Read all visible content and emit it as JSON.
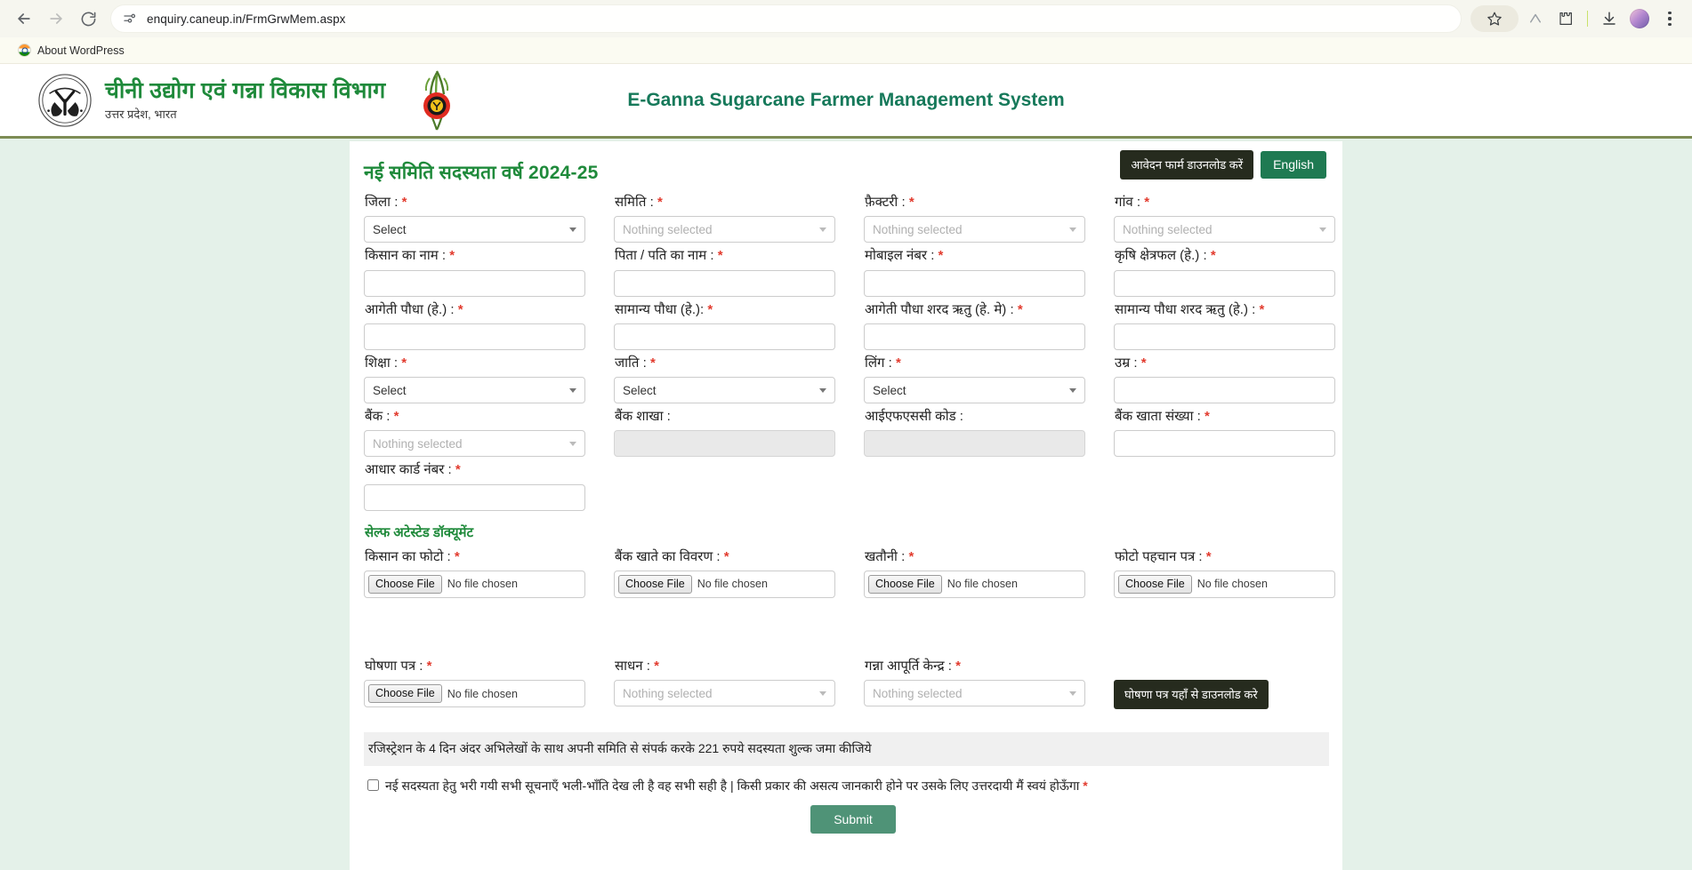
{
  "browser": {
    "url": "enquiry.caneup.in/FrmGrwMem.aspx",
    "back_icon": "back-arrow-icon",
    "forward_icon": "forward-arrow-icon",
    "reload_icon": "reload-icon",
    "site_info_icon": "site-settings-icon",
    "bookmarks": [
      {
        "label": "About WordPress",
        "icon": "india-flag-favicon"
      }
    ],
    "toolbar_icons": [
      "bookmark-star-icon",
      "lens-icon",
      "extensions-puzzle-icon",
      "downloads-icon",
      "profile-avatar",
      "chrome-menu-icon"
    ]
  },
  "site_header": {
    "emblem_icon": "up-government-emblem",
    "dept_title": "चीनी उद्योग एवं गन्ना विकास विभाग",
    "dept_subtitle": "उत्तर प्रदेश, भारत",
    "cane_logo_icon": "sugarcane-logo",
    "system_title": "E-Ganna Sugarcane Farmer Management System"
  },
  "colors": {
    "green": "#1f8a3b",
    "teal": "#16795a",
    "dark_button": "#262b1e",
    "green_button": "#1f7a52",
    "page_bg": "#e4f1e9",
    "required_star": "#e23b2e"
  },
  "form": {
    "title": "नई समिति सदस्यता वर्ष 2024-25",
    "download_form_button": "आवेदन फार्म डाउनलोड करें",
    "language_button": "English",
    "rows": [
      [
        {
          "label": "जिला :",
          "required": true,
          "type": "select",
          "value": "Select",
          "placeholder": false,
          "name": "district"
        },
        {
          "label": "समिति :",
          "required": true,
          "type": "select",
          "value": "Nothing selected",
          "placeholder": true,
          "name": "samiti"
        },
        {
          "label": "फ़ैक्टरी :",
          "required": true,
          "type": "select",
          "value": "Nothing selected",
          "placeholder": true,
          "name": "factory"
        },
        {
          "label": "गांव :",
          "required": true,
          "type": "select",
          "value": "Nothing selected",
          "placeholder": true,
          "name": "village"
        }
      ],
      [
        {
          "label": "किसान का नाम :",
          "required": true,
          "type": "text",
          "value": "",
          "name": "farmer-name"
        },
        {
          "label": "पिता / पति का नाम :",
          "required": true,
          "type": "text",
          "value": "",
          "name": "father-husband-name"
        },
        {
          "label": "मोबाइल नंबर :",
          "required": true,
          "type": "text",
          "value": "",
          "name": "mobile-number"
        },
        {
          "label": "कृषि क्षेत्रफल (हे.) :",
          "required": true,
          "type": "text",
          "value": "",
          "name": "agriculture-area"
        }
      ],
      [
        {
          "label": "आगेती पौधा (हे.) :",
          "required": true,
          "type": "text",
          "value": "",
          "name": "early-plant-area"
        },
        {
          "label": "सामान्य पौधा (हे.):",
          "required": true,
          "type": "text",
          "value": "",
          "name": "normal-plant-area"
        },
        {
          "label": "आगेती पौधा शरद ऋतु (हे. मे) :",
          "required": true,
          "type": "text",
          "value": "",
          "name": "early-plant-autumn"
        },
        {
          "label": "सामान्य पौधा शरद ऋतु (हे.) :",
          "required": true,
          "type": "text",
          "value": "",
          "name": "normal-plant-autumn"
        }
      ],
      [
        {
          "label": "शिक्षा :",
          "required": true,
          "type": "select",
          "value": "Select",
          "placeholder": false,
          "name": "education"
        },
        {
          "label": "जाति :",
          "required": true,
          "type": "select",
          "value": "Select",
          "placeholder": false,
          "name": "caste"
        },
        {
          "label": "लिंग :",
          "required": true,
          "type": "select",
          "value": "Select",
          "placeholder": false,
          "name": "gender"
        },
        {
          "label": "उम्र :",
          "required": true,
          "type": "text",
          "value": "",
          "name": "age"
        }
      ],
      [
        {
          "label": "बैंक :",
          "required": true,
          "type": "select",
          "value": "Nothing selected",
          "placeholder": true,
          "name": "bank"
        },
        {
          "label": "बैंक शाखा :",
          "required": false,
          "type": "text",
          "value": "",
          "disabled": true,
          "name": "bank-branch"
        },
        {
          "label": "आईएफएससी कोड :",
          "required": false,
          "type": "text",
          "value": "",
          "disabled": true,
          "name": "ifsc-code"
        },
        {
          "label": "बैंक खाता संख्या :",
          "required": true,
          "type": "text",
          "value": "",
          "name": "bank-account-number"
        }
      ],
      [
        {
          "label": "आधार कार्ड नंबर :",
          "required": true,
          "type": "text",
          "value": "",
          "name": "aadhaar-number"
        }
      ]
    ],
    "documents_section_title": "सेल्फ अटेस्टेड डॉक्यूमेंट",
    "file_button_label": "Choose File",
    "file_status_label": "No file chosen",
    "document_rows": [
      [
        {
          "label": "किसान का फोटो :",
          "required": true,
          "type": "file",
          "name": "farmer-photo"
        },
        {
          "label": "बैंक खाते का विवरण :",
          "required": true,
          "type": "file",
          "name": "bank-account-detail"
        },
        {
          "label": "खतौनी :",
          "required": true,
          "type": "file",
          "name": "khatauni"
        },
        {
          "label": "फोटो पहचान पत्र :",
          "required": true,
          "type": "file",
          "name": "photo-id-proof"
        }
      ],
      [
        {
          "label": "घोषणा पत्र :",
          "required": true,
          "type": "file",
          "name": "declaration-form"
        },
        {
          "label": "साधन :",
          "required": true,
          "type": "select",
          "value": "Nothing selected",
          "placeholder": true,
          "name": "sadhan"
        },
        {
          "label": "गन्ना आपूर्ति केन्द्र :",
          "required": true,
          "type": "select",
          "value": "Nothing selected",
          "placeholder": true,
          "name": "cane-supply-center"
        }
      ]
    ],
    "declaration_download_button": "घोषणा पत्र यहाँ से डाउनलोड करे",
    "fee_note": "रजिस्ट्रेशन के 4 दिन अंदर अभिलेखों के साथ अपनी समिति से संपर्क करके 221 रुपये सदस्यता शुल्क जमा कीजिये",
    "consent_text": "नई सदस्यता हेतु भरी गयी सभी सूचनाएँ भली-भाँति देख ली है वह सभी सही है | किसी प्रकार की असत्य जानकारी होने पर उसके लिए उत्तरदायी मैं स्वयं होऊँगा",
    "submit_button": "Submit"
  }
}
